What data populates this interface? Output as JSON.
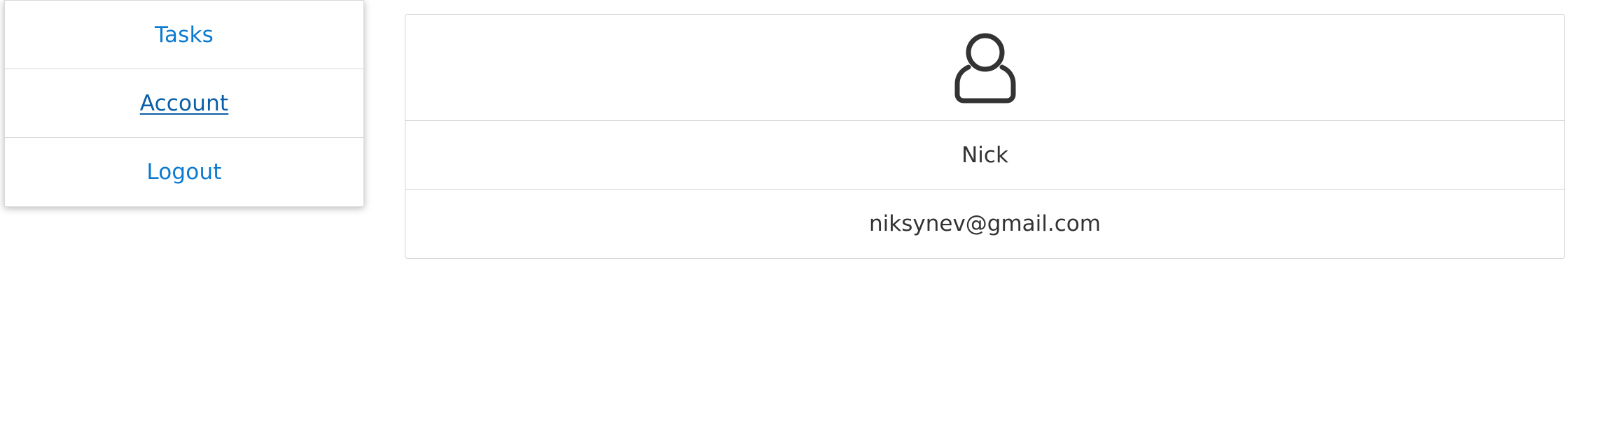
{
  "sidebar": {
    "items": [
      {
        "label": "Tasks",
        "active": false
      },
      {
        "label": "Account",
        "active": true
      },
      {
        "label": "Logout",
        "active": false
      }
    ]
  },
  "profile": {
    "avatar_icon": "user-icon",
    "name": "Nick",
    "email": "niksynev@gmail.com"
  },
  "colors": {
    "link": "#0b7ad1",
    "link_active": "#0a5ea8",
    "text": "#333333",
    "border": "#d4d4d4"
  }
}
